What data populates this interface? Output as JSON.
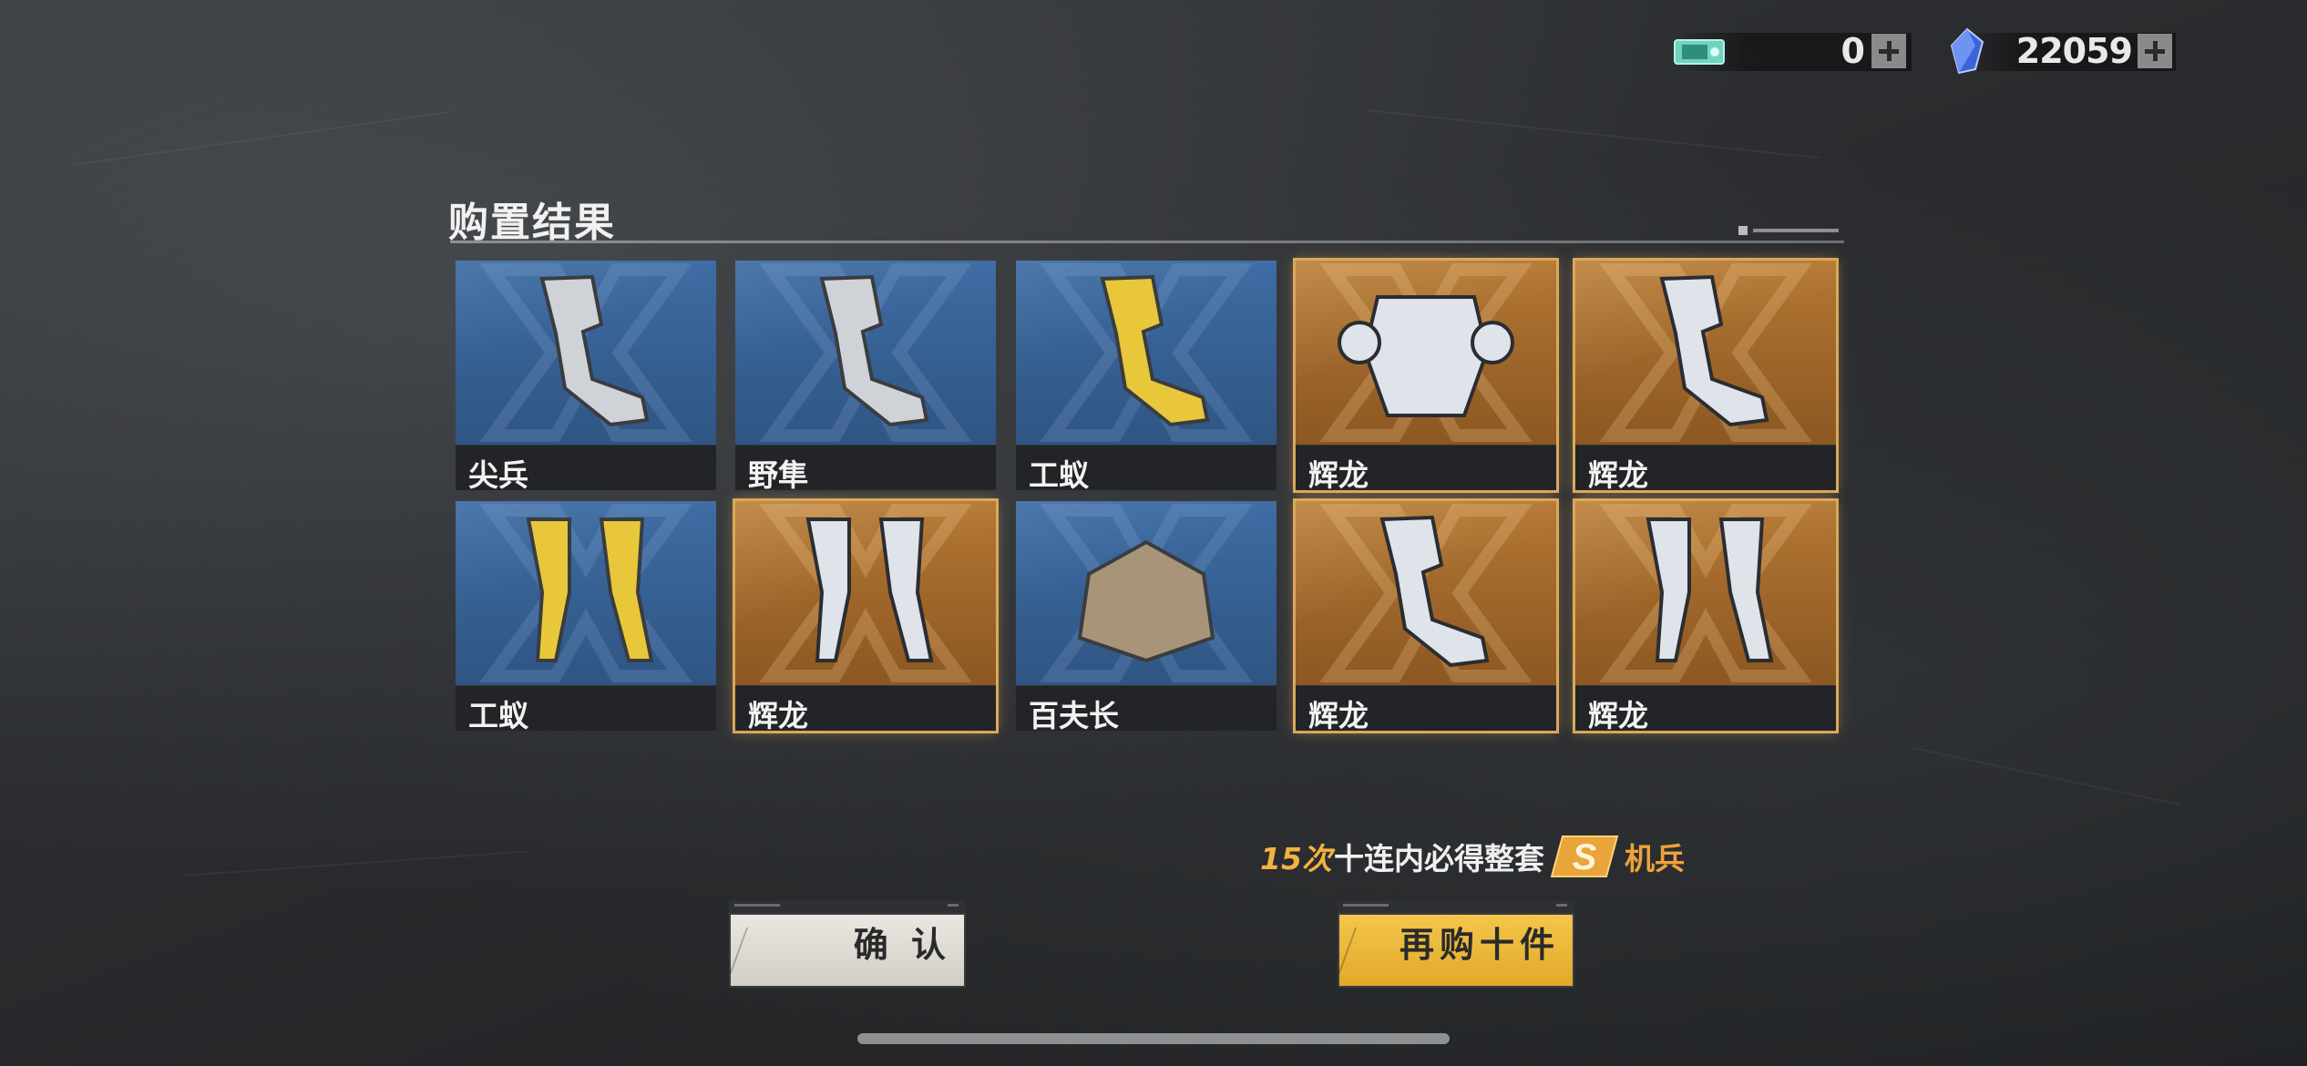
{
  "currency": {
    "ticket": {
      "icon": "ticket-icon",
      "value": "0"
    },
    "crystal": {
      "icon": "crystal-icon",
      "value": "22059"
    }
  },
  "panel": {
    "title": "购置结果"
  },
  "items": [
    {
      "name": "尖兵",
      "rarity": "blue",
      "icon": "mech-arm-icon"
    },
    {
      "name": "野隼",
      "rarity": "blue",
      "icon": "mech-arm-icon"
    },
    {
      "name": "工蚁",
      "rarity": "blue",
      "icon": "mech-arm-icon"
    },
    {
      "name": "辉龙",
      "rarity": "gold",
      "icon": "mech-torso-icon"
    },
    {
      "name": "辉龙",
      "rarity": "gold",
      "icon": "mech-arm-icon"
    },
    {
      "name": "工蚁",
      "rarity": "blue",
      "icon": "mech-legs-icon"
    },
    {
      "name": "辉龙",
      "rarity": "gold",
      "icon": "mech-legs-icon"
    },
    {
      "name": "百夫长",
      "rarity": "blue",
      "icon": "mech-head-icon"
    },
    {
      "name": "辉龙",
      "rarity": "gold",
      "icon": "mech-arm-icon"
    },
    {
      "name": "辉龙",
      "rarity": "gold",
      "icon": "mech-legs-icon"
    }
  ],
  "promo": {
    "count": "15次",
    "text": "十连内必得整套",
    "badge": "S",
    "tail": "机兵"
  },
  "buttons": {
    "confirm": "确 认",
    "rebuy": "再购十件"
  },
  "colors": {
    "gold_accent": "#f3b23f",
    "blue_card": "#3e6ca3",
    "gold_card": "#b47733"
  }
}
